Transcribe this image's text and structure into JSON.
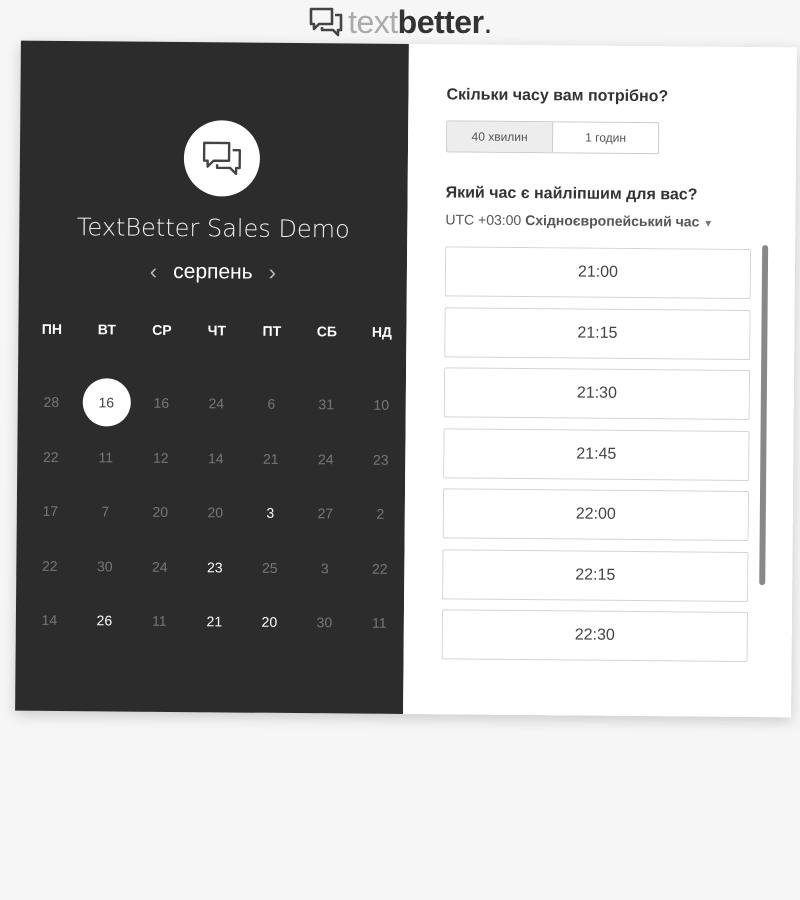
{
  "brand": {
    "part1": "text",
    "part2": "better",
    "dot": "."
  },
  "calendar": {
    "title": "TextBetter Sales Demo",
    "month": "серпень",
    "prev_icon": "chevron-left-icon",
    "next_icon": "chevron-right-icon",
    "weekdays": [
      "ПН",
      "ВТ",
      "СР",
      "ЧТ",
      "ПТ",
      "СБ",
      "НД"
    ],
    "weeks": [
      [
        {
          "d": "28",
          "a": false
        },
        {
          "d": "16",
          "a": true,
          "selected": true
        },
        {
          "d": "16",
          "a": false
        },
        {
          "d": "24",
          "a": false
        },
        {
          "d": "6",
          "a": false
        },
        {
          "d": "31",
          "a": false
        },
        {
          "d": "10",
          "a": false
        }
      ],
      [
        {
          "d": "22",
          "a": false
        },
        {
          "d": "11",
          "a": false
        },
        {
          "d": "12",
          "a": false
        },
        {
          "d": "14",
          "a": false
        },
        {
          "d": "21",
          "a": false
        },
        {
          "d": "24",
          "a": false
        },
        {
          "d": "23",
          "a": false
        }
      ],
      [
        {
          "d": "17",
          "a": false
        },
        {
          "d": "7",
          "a": false
        },
        {
          "d": "20",
          "a": false
        },
        {
          "d": "20",
          "a": false
        },
        {
          "d": "3",
          "a": true
        },
        {
          "d": "27",
          "a": false
        },
        {
          "d": "2",
          "a": false
        }
      ],
      [
        {
          "d": "22",
          "a": false
        },
        {
          "d": "30",
          "a": false
        },
        {
          "d": "24",
          "a": false
        },
        {
          "d": "23",
          "a": true
        },
        {
          "d": "25",
          "a": false
        },
        {
          "d": "3",
          "a": false
        },
        {
          "d": "22",
          "a": false
        }
      ],
      [
        {
          "d": "14",
          "a": false
        },
        {
          "d": "26",
          "a": true
        },
        {
          "d": "11",
          "a": false
        },
        {
          "d": "21",
          "a": true
        },
        {
          "d": "20",
          "a": true
        },
        {
          "d": "30",
          "a": false
        },
        {
          "d": "11",
          "a": false
        }
      ]
    ]
  },
  "booking": {
    "duration_question": "Скільки часу вам потрібно?",
    "durations": [
      "40 хвилин",
      "1 годин"
    ],
    "time_question": "Який час є найліпшим для вас?",
    "tz_offset": "UTC +03:00",
    "tz_name": "Східноєвропейський час",
    "slots": [
      "21:00",
      "21:15",
      "21:30",
      "21:45",
      "22:00",
      "22:15",
      "22:30",
      ""
    ]
  },
  "colors": {
    "panel_dark": "#2c2c2c",
    "available_day": "#ffffff",
    "unavailable_day": "#777777"
  }
}
